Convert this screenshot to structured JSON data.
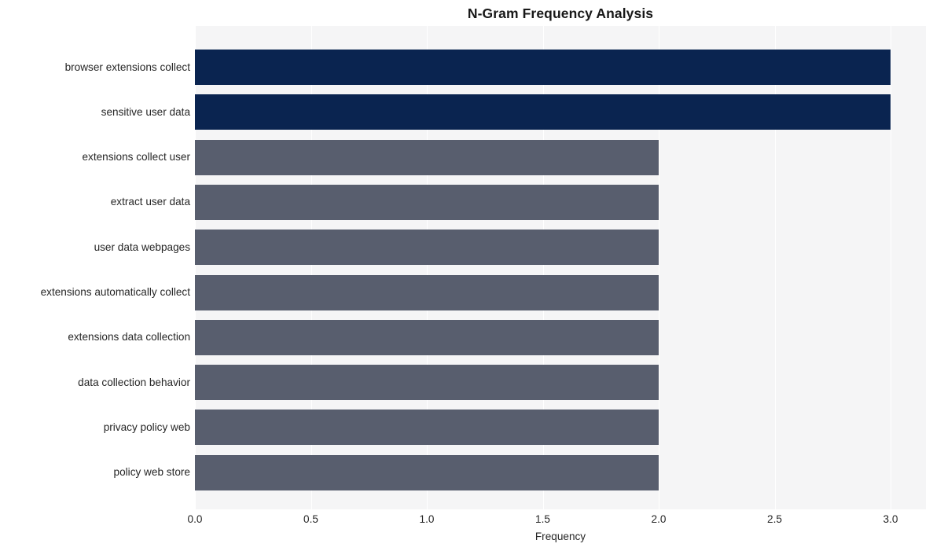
{
  "chart_data": {
    "type": "bar",
    "orientation": "horizontal",
    "title": "N-Gram Frequency Analysis",
    "xlabel": "Frequency",
    "ylabel": "",
    "xlim": [
      0.0,
      3.0
    ],
    "xticks": [
      "0.0",
      "0.5",
      "1.0",
      "1.5",
      "2.0",
      "2.5",
      "3.0"
    ],
    "xtick_values": [
      0.0,
      0.5,
      1.0,
      1.5,
      2.0,
      2.5,
      3.0
    ],
    "grid": "vertical",
    "legend": "none",
    "plot_background": "#f5f5f6",
    "categories": [
      "browser extensions collect",
      "sensitive user data",
      "extensions collect user",
      "extract user data",
      "user data webpages",
      "extensions automatically collect",
      "extensions data collection",
      "data collection behavior",
      "privacy policy web",
      "policy web store"
    ],
    "values": [
      3,
      3,
      2,
      2,
      2,
      2,
      2,
      2,
      2,
      2
    ],
    "bar_colors": [
      "#0a2450",
      "#0a2450",
      "#585e6e",
      "#585e6e",
      "#585e6e",
      "#585e6e",
      "#585e6e",
      "#585e6e",
      "#585e6e",
      "#585e6e"
    ],
    "colors": {
      "high": "#0a2450",
      "low": "#585e6e",
      "text": "#262626",
      "title": "#181818",
      "grid": "#ffffff",
      "plot_bg": "#f5f5f6",
      "figure_bg": "#ffffff"
    }
  }
}
